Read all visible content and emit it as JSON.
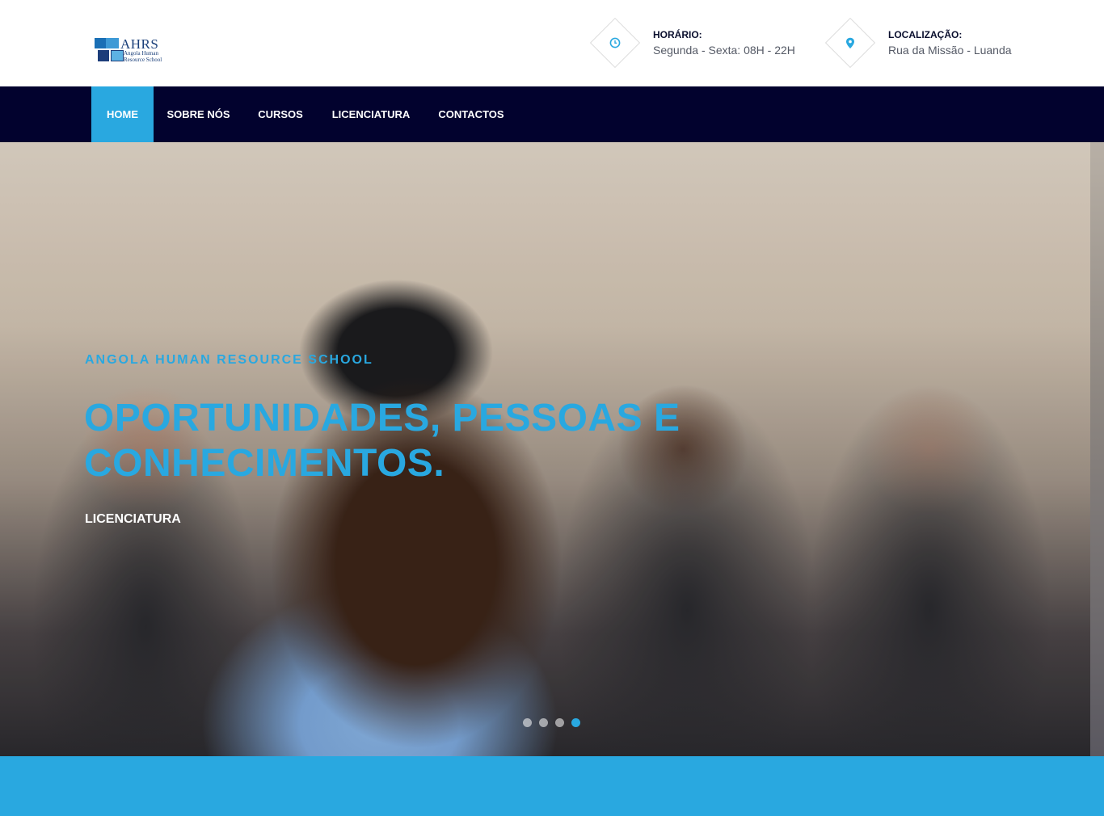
{
  "header": {
    "logo": {
      "title": "AHRS",
      "subtitle": "Angola Human Resource School"
    },
    "hours": {
      "label": "HORÁRIO:",
      "value": "Segunda - Sexta: 08H - 22H",
      "icon": "clock-icon"
    },
    "location": {
      "label": "LOCALIZAÇÃO:",
      "value": "Rua da Missão - Luanda",
      "icon": "map-pin-icon"
    }
  },
  "nav": {
    "items": [
      {
        "label": "HOME",
        "active": true
      },
      {
        "label": "SOBRE NÓS",
        "active": false
      },
      {
        "label": "CURSOS",
        "active": false
      },
      {
        "label": "LICENCIATURA",
        "active": false
      },
      {
        "label": "CONTACTOS",
        "active": false
      }
    ]
  },
  "hero": {
    "kicker": "ANGOLA HUMAN RESOURCE SCHOOL",
    "title": "OPORTUNIDADES, PESSOAS E CONHECIMENTOS.",
    "cta": "LICENCIATURA",
    "slides_total": 4,
    "active_slide": 4
  },
  "colors": {
    "accent": "#29a8e0",
    "nav_bg": "#02022e",
    "label": "#0a0f2e",
    "muted": "#555a66"
  }
}
